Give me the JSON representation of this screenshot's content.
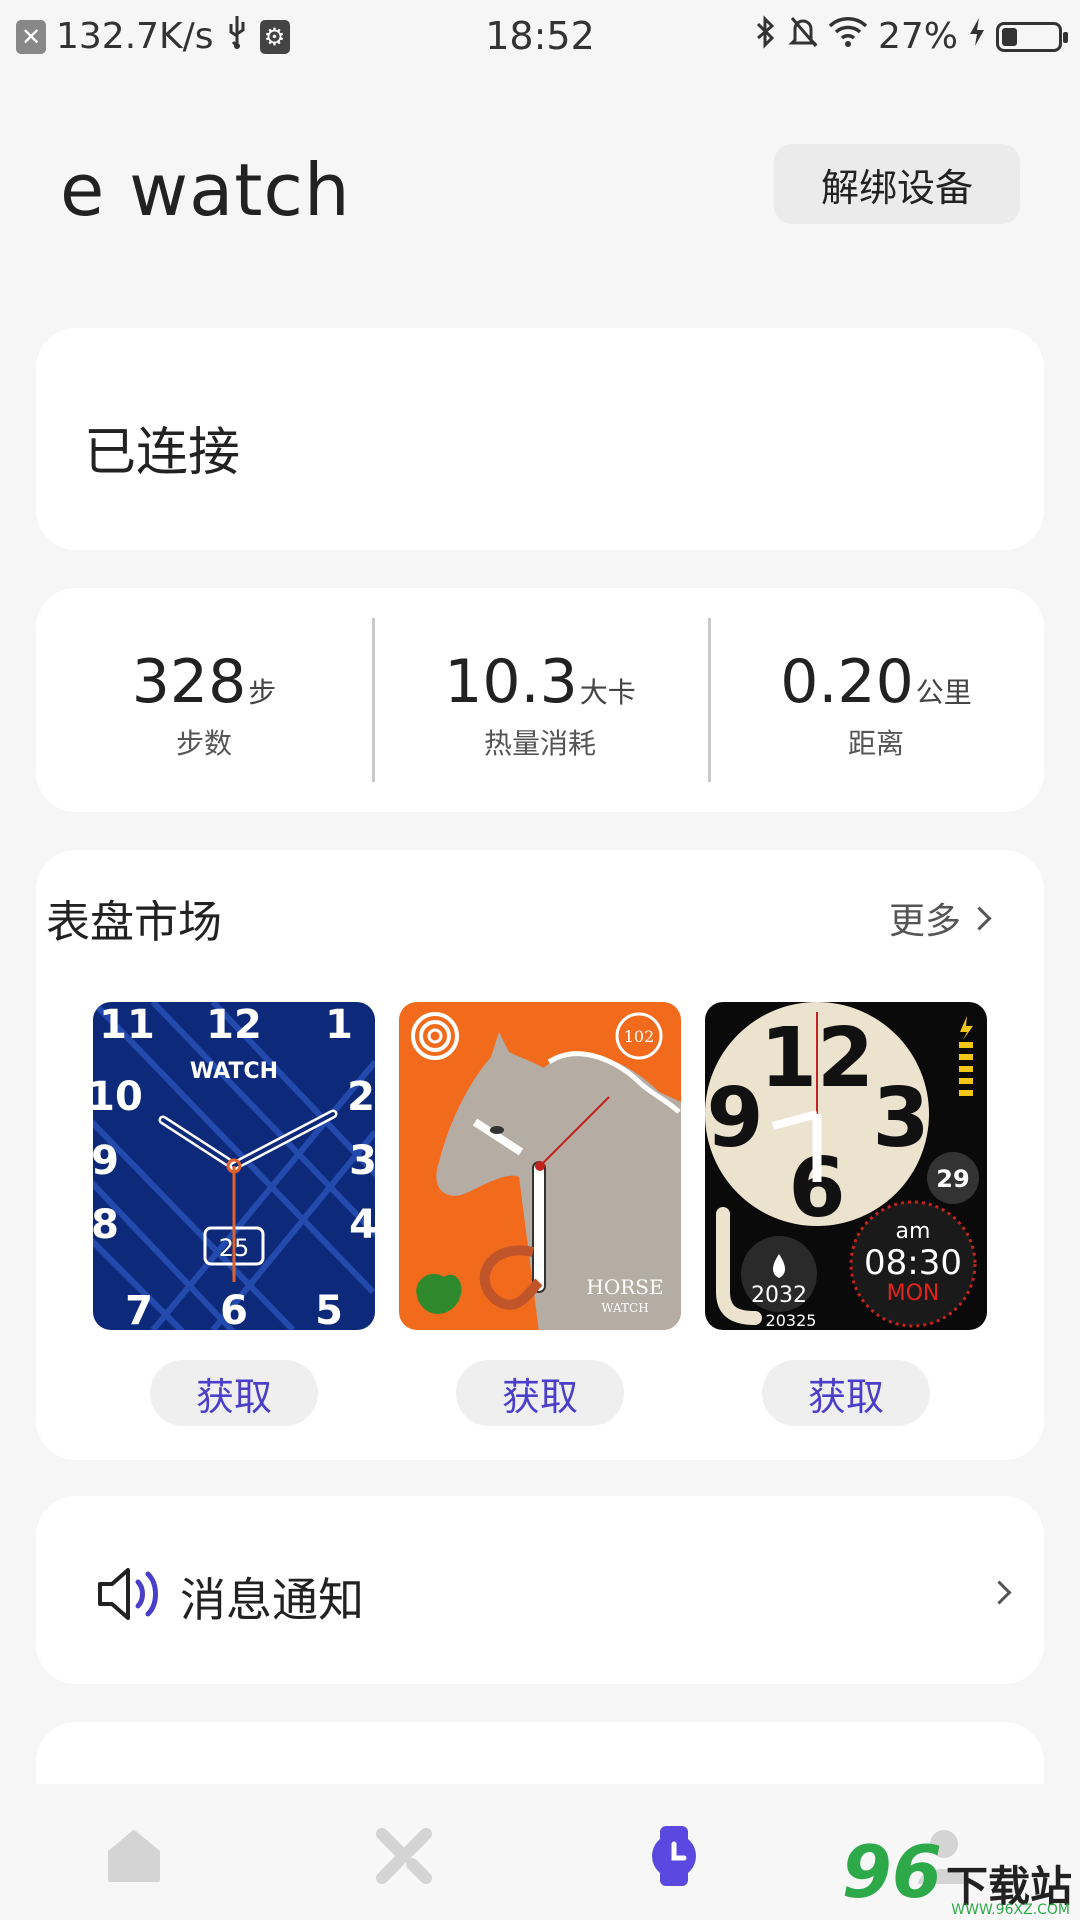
{
  "status_bar": {
    "net_speed": "132.7K/s",
    "time": "18:52",
    "battery_percent": "27%",
    "battery_level": 0.27,
    "icons": [
      "close-box-icon",
      "usb-icon",
      "usb-debug-icon",
      "bluetooth-icon",
      "bell-muted-icon",
      "wifi-icon",
      "charging-icon",
      "battery-icon"
    ]
  },
  "header": {
    "title": "e watch",
    "unbind_label": "解绑设备"
  },
  "connection": {
    "status": "已连接"
  },
  "stats": [
    {
      "value": "328",
      "unit": "步",
      "label": "步数"
    },
    {
      "value": "10.3",
      "unit": "大卡",
      "label": "热量消耗"
    },
    {
      "value": "0.20",
      "unit": "公里",
      "label": "距离"
    }
  ],
  "market": {
    "title": "表盘市场",
    "more_label": "更多",
    "faces": [
      {
        "name": "blue-analog-face",
        "texts": [
          "11",
          "12",
          "1",
          "WATCH",
          "10",
          "2",
          "9",
          "3",
          "8",
          "4",
          "25",
          "7",
          "6",
          "5"
        ],
        "get_label": "获取"
      },
      {
        "name": "horse-face",
        "texts": [
          "102",
          "HORSE",
          "WATCH"
        ],
        "get_label": "获取"
      },
      {
        "name": "big-numeral-face",
        "texts": [
          "12",
          "9",
          "3",
          "6",
          "29",
          "am",
          "08:30",
          "MON",
          "2032",
          "20325"
        ],
        "get_label": "获取"
      }
    ]
  },
  "notification": {
    "label": "消息通知"
  },
  "bottom_nav": {
    "items": [
      "home-icon",
      "sport-icon",
      "watch-icon",
      "profile-icon"
    ],
    "active_index": 2
  },
  "watermark": {
    "number": "96",
    "text": "下载站",
    "url": "WWW.96XZ.COM"
  },
  "colors": {
    "accent": "#4b3ec9",
    "card": "#ffffff",
    "background": "#f6f6f6"
  }
}
